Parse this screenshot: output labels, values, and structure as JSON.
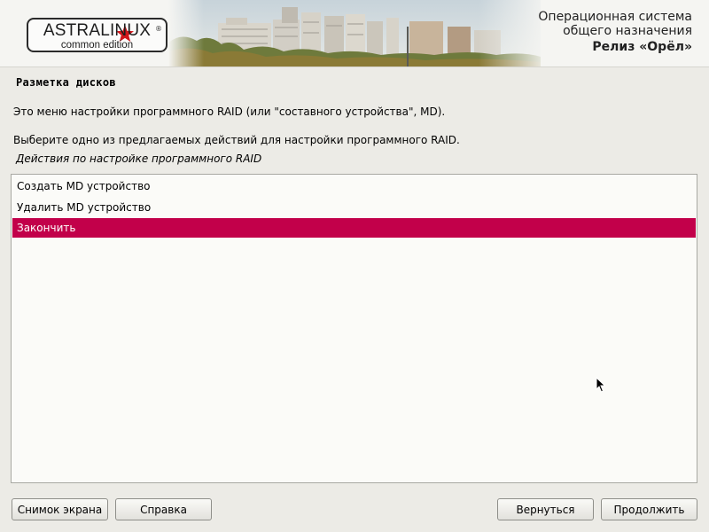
{
  "header": {
    "logo_name": "ASTRALINUX",
    "logo_reg": "®",
    "logo_edition": "common edition",
    "os_line1": "Операционная система",
    "os_line2": "общего назначения",
    "release": "Релиз «Орёл»"
  },
  "page": {
    "title": "Разметка дисков",
    "description1": "Это меню настройки программного RAID (или \"составного устройства\", MD).",
    "description2": "Выберите одно из предлагаемых действий для настройки программного RAID.",
    "list_caption": "Действия по настройке программного RAID"
  },
  "actions": {
    "items": [
      {
        "label": "Создать MD устройство"
      },
      {
        "label": "Удалить MD устройство"
      },
      {
        "label": "Закончить"
      }
    ],
    "selected_index": 2
  },
  "buttons": {
    "screenshot": "Снимок экрана",
    "help": "Справка",
    "back": "Вернуться",
    "continue": "Продолжить"
  },
  "colors": {
    "selection": "#c2004a",
    "background": "#ecebe6",
    "logo_star": "#d0151b"
  },
  "icons": {
    "logo_star": "star-icon",
    "pointer": "mouse-pointer-icon"
  }
}
